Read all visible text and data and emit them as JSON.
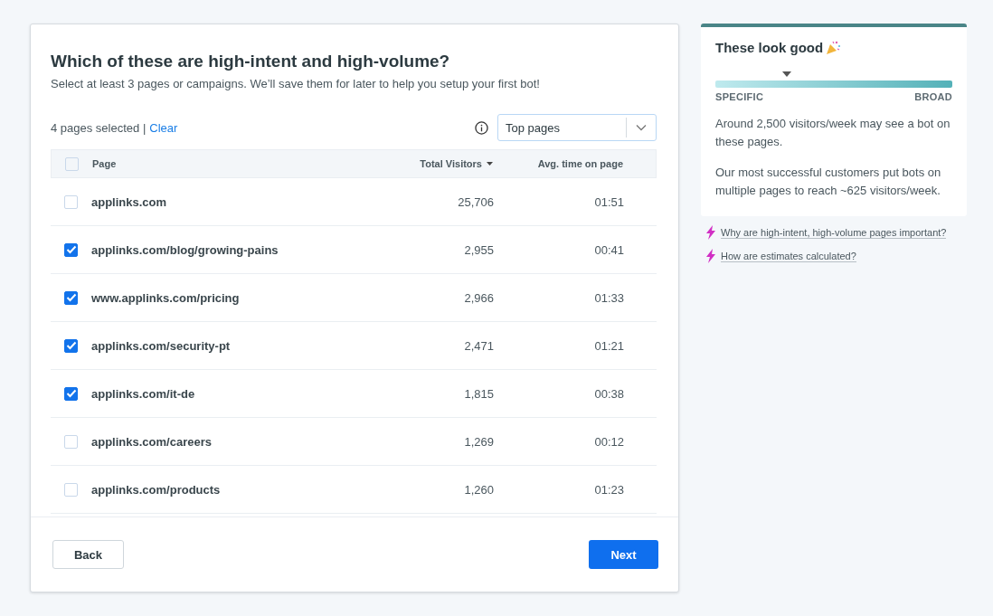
{
  "main": {
    "title": "Which of these are high-intent and high-volume?",
    "subtitle": "Select at least 3 pages or campaigns. We’ll save them for later to help you setup your first bot!",
    "selection_count": "4 pages selected |",
    "clear_link": "Clear",
    "filter": {
      "value": "Top pages"
    },
    "table": {
      "select_all": {
        "checked": false
      },
      "columns": [
        "Page",
        "Total Visitors",
        "Avg. time on page"
      ],
      "rows": [
        {
          "page": "applinks.com",
          "visitors": "25,706",
          "time": "01:51",
          "checked": false
        },
        {
          "page": "applinks.com/blog/growing-pains",
          "visitors": "2,955",
          "time": "00:41",
          "checked": true
        },
        {
          "page": "www.applinks.com/pricing",
          "visitors": "2,966",
          "time": "01:33",
          "checked": true
        },
        {
          "page": "applinks.com/security-pt",
          "visitors": "2,471",
          "time": "01:21",
          "checked": true
        },
        {
          "page": "applinks.com/it-de",
          "visitors": "1,815",
          "time": "00:38",
          "checked": true
        },
        {
          "page": "applinks.com/careers",
          "visitors": "1,269",
          "time": "00:12",
          "checked": false
        },
        {
          "page": "applinks.com/products",
          "visitors": "1,260",
          "time": "01:23",
          "checked": false
        }
      ]
    },
    "buttons": {
      "back": "Back",
      "next": "Next"
    }
  },
  "side": {
    "title": "These look good",
    "meter": {
      "level": 0.3,
      "left_label": "SPECIFIC",
      "right_label": "BROAD"
    },
    "paragraphs": [
      "Around 2,500 visitors/week may see a bot on these pages.",
      "Our most successful customers put bots on multiple pages to reach ~625 visitors/week."
    ],
    "links": [
      "Why are high-intent, high-volume pages important?",
      "How are estimates calculated?"
    ]
  }
}
